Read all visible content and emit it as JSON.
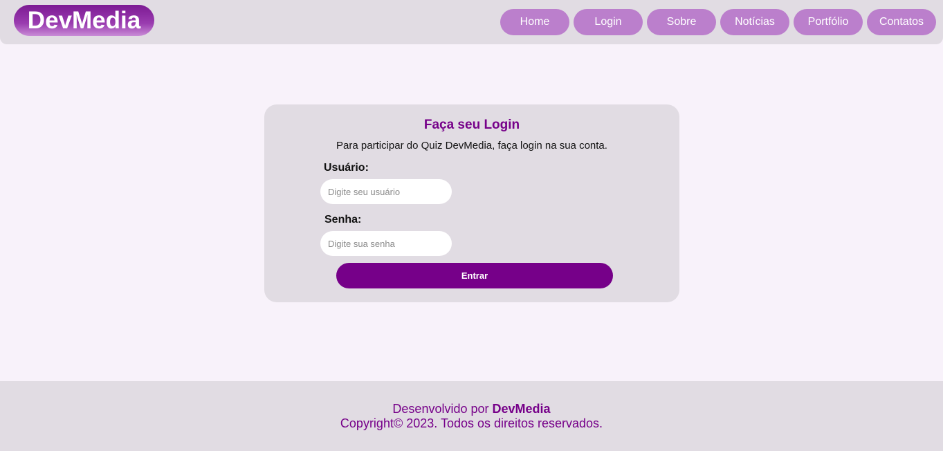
{
  "header": {
    "logo": "DevMedia",
    "nav": [
      "Home",
      "Login",
      "Sobre",
      "Notícias",
      "Portfólio",
      "Contatos"
    ]
  },
  "login": {
    "title": "Faça seu Login",
    "subtitle": "Para participar do Quiz DevMedia, faça login na sua conta.",
    "user_label": "Usuário:",
    "user_placeholder": "Digite seu usuário",
    "password_label": "Senha:",
    "password_placeholder": "Digite sua senha",
    "submit_label": "Entrar"
  },
  "footer": {
    "dev_prefix": "Desenvolvido por",
    "dev_brand": "DevMedia",
    "copyright": "Copyright© 2023. Todos os direitos reservados."
  },
  "colors": {
    "accent": "#760089",
    "nav_button": "#bb7fcc",
    "panel": "#e1dce3",
    "page_bg": "#f8f2fa"
  }
}
